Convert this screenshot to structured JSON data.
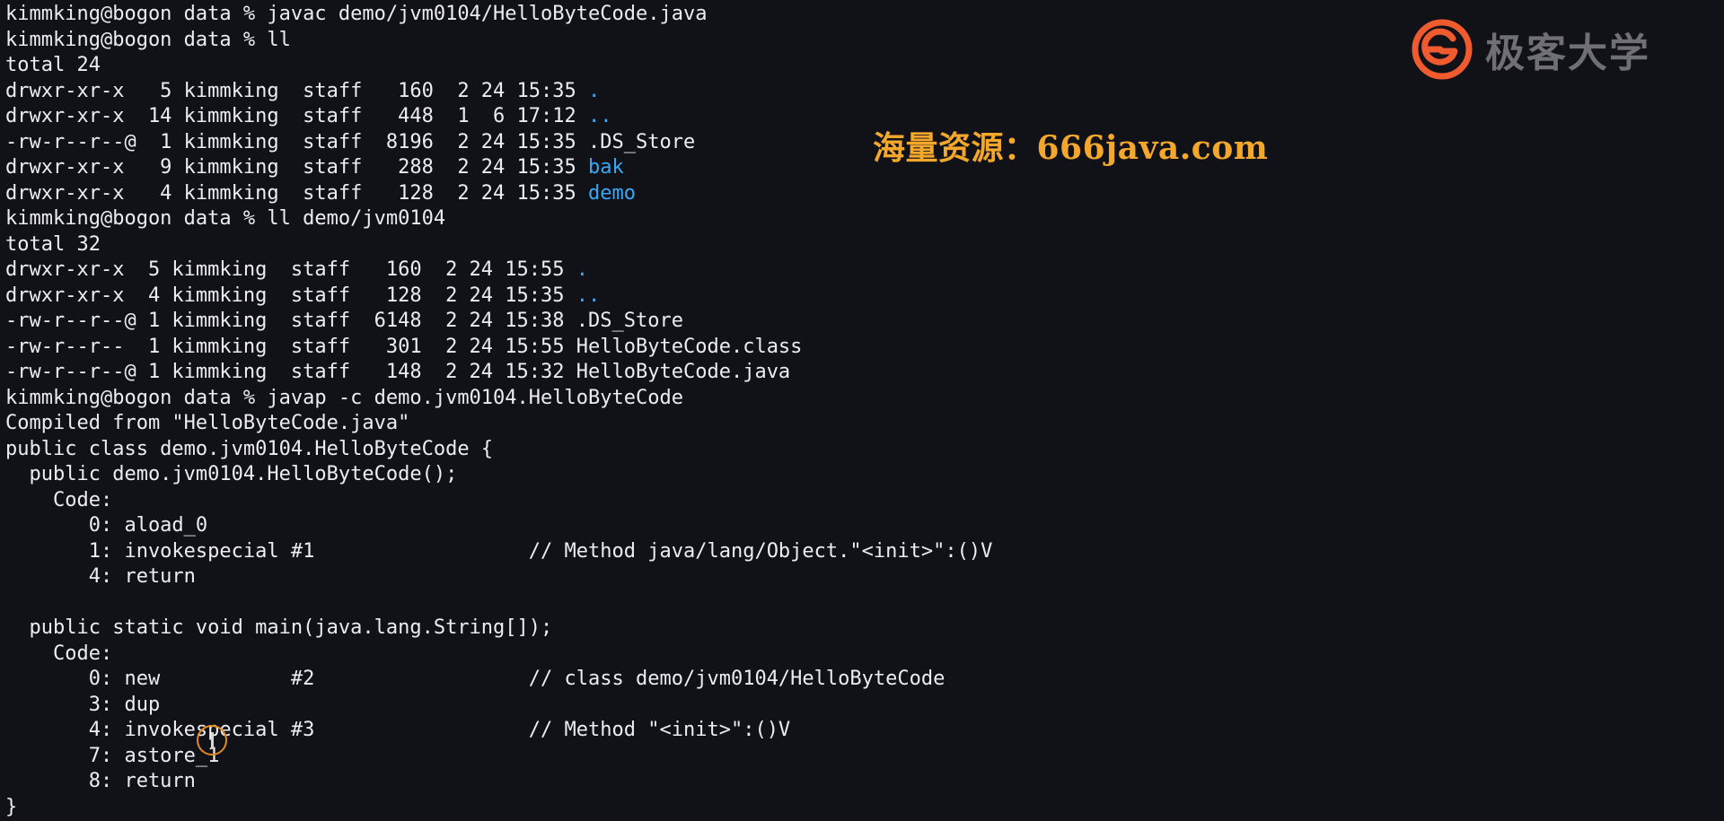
{
  "app": "terminal",
  "logo": {
    "brand_text": "极客大学",
    "icon": "geek-university-g-logo"
  },
  "watermark": "海量资源：666java.com",
  "colors": {
    "terminal_background": "#111118",
    "terminal_text": "#ececf1",
    "directory_accent": "#39a9f5",
    "watermark": "#f3a82c",
    "logo_text": "#6f6f74",
    "logo_brand": "#ef5a2f",
    "cursor_ring": "#e18a22"
  },
  "terminal": {
    "lines": [
      [
        {
          "text": "kimmking@bogon data % javac demo/jvm0104/HelloByteCode.java"
        }
      ],
      [
        {
          "text": "kimmking@bogon data % ll"
        }
      ],
      [
        {
          "text": "total 24"
        }
      ],
      [
        {
          "text": "drwxr-xr-x   5 kimmking  staff   160  2 24 15:35 "
        },
        {
          "text": ".",
          "kind": "dir"
        }
      ],
      [
        {
          "text": "drwxr-xr-x  14 kimmking  staff   448  1  6 17:12 "
        },
        {
          "text": "..",
          "kind": "dir"
        }
      ],
      [
        {
          "text": "-rw-r--r--@  1 kimmking  staff  8196  2 24 15:35 .DS_Store"
        }
      ],
      [
        {
          "text": "drwxr-xr-x   9 kimmking  staff   288  2 24 15:35 "
        },
        {
          "text": "bak",
          "kind": "dir"
        }
      ],
      [
        {
          "text": "drwxr-xr-x   4 kimmking  staff   128  2 24 15:35 "
        },
        {
          "text": "demo",
          "kind": "dir"
        }
      ],
      [
        {
          "text": "kimmking@bogon data % ll demo/jvm0104"
        }
      ],
      [
        {
          "text": "total 32"
        }
      ],
      [
        {
          "text": "drwxr-xr-x  5 kimmking  staff   160  2 24 15:55 "
        },
        {
          "text": ".",
          "kind": "dir"
        }
      ],
      [
        {
          "text": "drwxr-xr-x  4 kimmking  staff   128  2 24 15:35 "
        },
        {
          "text": "..",
          "kind": "dir"
        }
      ],
      [
        {
          "text": "-rw-r--r--@ 1 kimmking  staff  6148  2 24 15:38 .DS_Store"
        }
      ],
      [
        {
          "text": "-rw-r--r--  1 kimmking  staff   301  2 24 15:55 HelloByteCode.class"
        }
      ],
      [
        {
          "text": "-rw-r--r--@ 1 kimmking  staff   148  2 24 15:32 HelloByteCode.java"
        }
      ],
      [
        {
          "text": "kimmking@bogon data % javap -c demo.jvm0104.HelloByteCode"
        }
      ],
      [
        {
          "text": "Compiled from \"HelloByteCode.java\""
        }
      ],
      [
        {
          "text": "public class demo.jvm0104.HelloByteCode {"
        }
      ],
      [
        {
          "text": "  public demo.jvm0104.HelloByteCode();"
        }
      ],
      [
        {
          "text": "    Code:"
        }
      ],
      [
        {
          "text": "       0: aload_0"
        }
      ],
      [
        {
          "text": "       1: invokespecial #1                  // Method java/lang/Object.\"<init>\":()V"
        }
      ],
      [
        {
          "text": "       4: return"
        }
      ],
      [
        {
          "text": ""
        }
      ],
      [
        {
          "text": "  public static void main(java.lang.String[]);"
        }
      ],
      [
        {
          "text": "    Code:"
        }
      ],
      [
        {
          "text": "       0: new           #2                  // class demo/jvm0104/HelloByteCode"
        }
      ],
      [
        {
          "text": "       3: dup"
        }
      ],
      [
        {
          "text": "       4: invokespecial #3                  // Method \"<init>\":()V"
        }
      ],
      [
        {
          "text": "       7: astore_1"
        }
      ],
      [
        {
          "text": "       8: return"
        }
      ],
      [
        {
          "text": "}"
        }
      ]
    ]
  },
  "cursor": {
    "icon": "text-cursor-icon"
  }
}
